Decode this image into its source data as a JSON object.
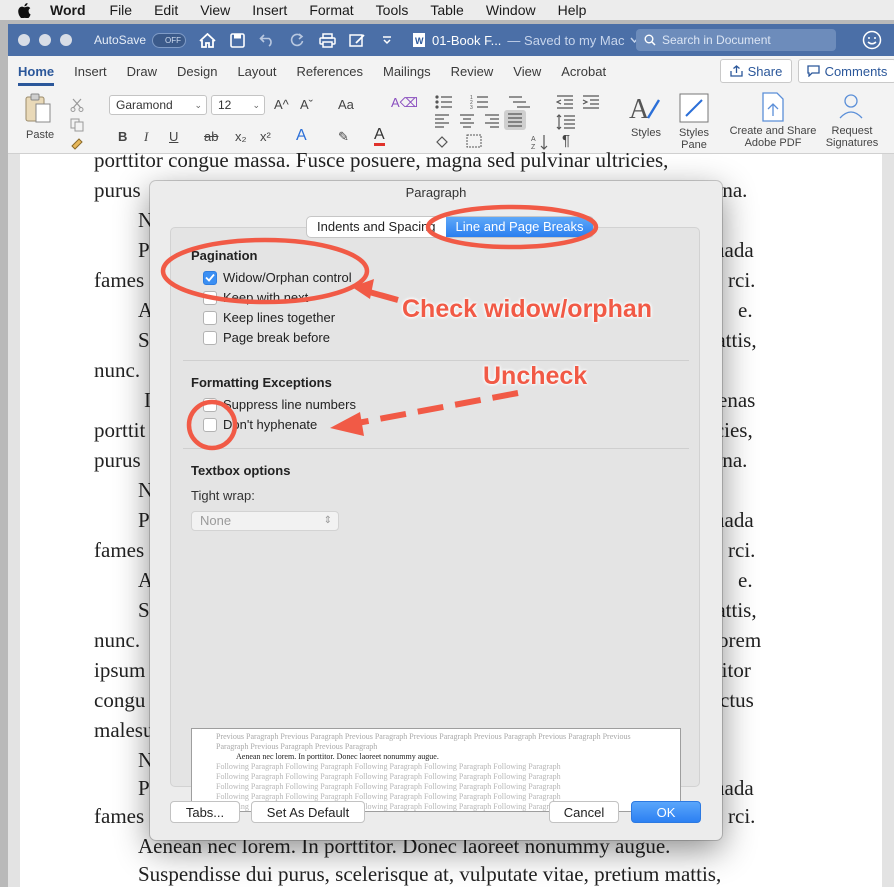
{
  "menubar": {
    "items": [
      "Word",
      "File",
      "Edit",
      "View",
      "Insert",
      "Format",
      "Tools",
      "Table",
      "Window",
      "Help"
    ]
  },
  "titlebar": {
    "autosave_label": "AutoSave",
    "autosave_state": "OFF",
    "doc_title": "01-Book F...",
    "doc_status": "— Saved to my Mac",
    "search_placeholder": "Search in Document"
  },
  "tabs": [
    "Home",
    "Insert",
    "Draw",
    "Design",
    "Layout",
    "References",
    "Mailings",
    "Review",
    "View",
    "Acrobat"
  ],
  "share_label": "Share",
  "comments_label": "Comments",
  "ribbon": {
    "paste": "Paste",
    "font_name": "Garamond",
    "font_size": "12",
    "styles": "Styles",
    "styles_pane": "Styles Pane",
    "create_share_pdf": "Create and Share Adobe PDF",
    "request_signatures": "Request Signatures"
  },
  "document": {
    "lines": [
      "porttitor congue massa. Fusce posuere, magna sed pulvinar ultricies,",
      "purus",
      "arna.",
      "N",
      "P",
      "uada",
      "fames",
      "rci.",
      "A",
      "e.",
      "S",
      "mattis,",
      "nunc.",
      "I",
      "enas",
      "porttit",
      "ricies,",
      "purus",
      "arna.",
      "N",
      "P",
      "uada",
      "fames",
      "rci.",
      "A",
      "e.",
      "S",
      "mattis,",
      "nunc.",
      "orem",
      "ipsum",
      "ttitor",
      "congu",
      "ctus",
      "malesu",
      "N",
      "P",
      "uada",
      "fames",
      "rci.",
      "Aenean nec lorem. In porttitor. Donec laoreet nonummy augue.",
      "Suspendisse dui purus, scelerisque at, vulputate vitae, pretium mattis,"
    ]
  },
  "dialog": {
    "title": "Paragraph",
    "tabs": [
      "Indents and Spacing",
      "Line and Page Breaks"
    ],
    "pagination_heading": "Pagination",
    "pagination": [
      {
        "label": "Widow/Orphan control",
        "checked": true
      },
      {
        "label": "Keep with next",
        "checked": false
      },
      {
        "label": "Keep lines together",
        "checked": false
      },
      {
        "label": "Page break before",
        "checked": false
      }
    ],
    "exceptions_heading": "Formatting Exceptions",
    "exceptions": [
      {
        "label": "Suppress line numbers",
        "checked": false
      },
      {
        "label": "Don't hyphenate",
        "checked": false
      }
    ],
    "textbox_heading": "Textbox options",
    "tight_wrap_label": "Tight wrap:",
    "tight_wrap_value": "None",
    "preview": {
      "previous": "Previous Paragraph Previous Paragraph Previous Paragraph Previous Paragraph Previous Paragraph Previous Paragraph Previous Paragraph Previous Paragraph Previous Paragraph",
      "current": "Aenean nec lorem. In porttitor. Donec laoreet nonummy augue.",
      "following": "Following Paragraph Following Paragraph Following Paragraph Following Paragraph Following Paragraph"
    },
    "buttons": {
      "tabs": "Tabs...",
      "set_default": "Set As Default",
      "cancel": "Cancel",
      "ok": "OK"
    }
  },
  "annotations": {
    "check": "Check widow/orphan",
    "uncheck": "Uncheck",
    "color": "#f15a46"
  }
}
